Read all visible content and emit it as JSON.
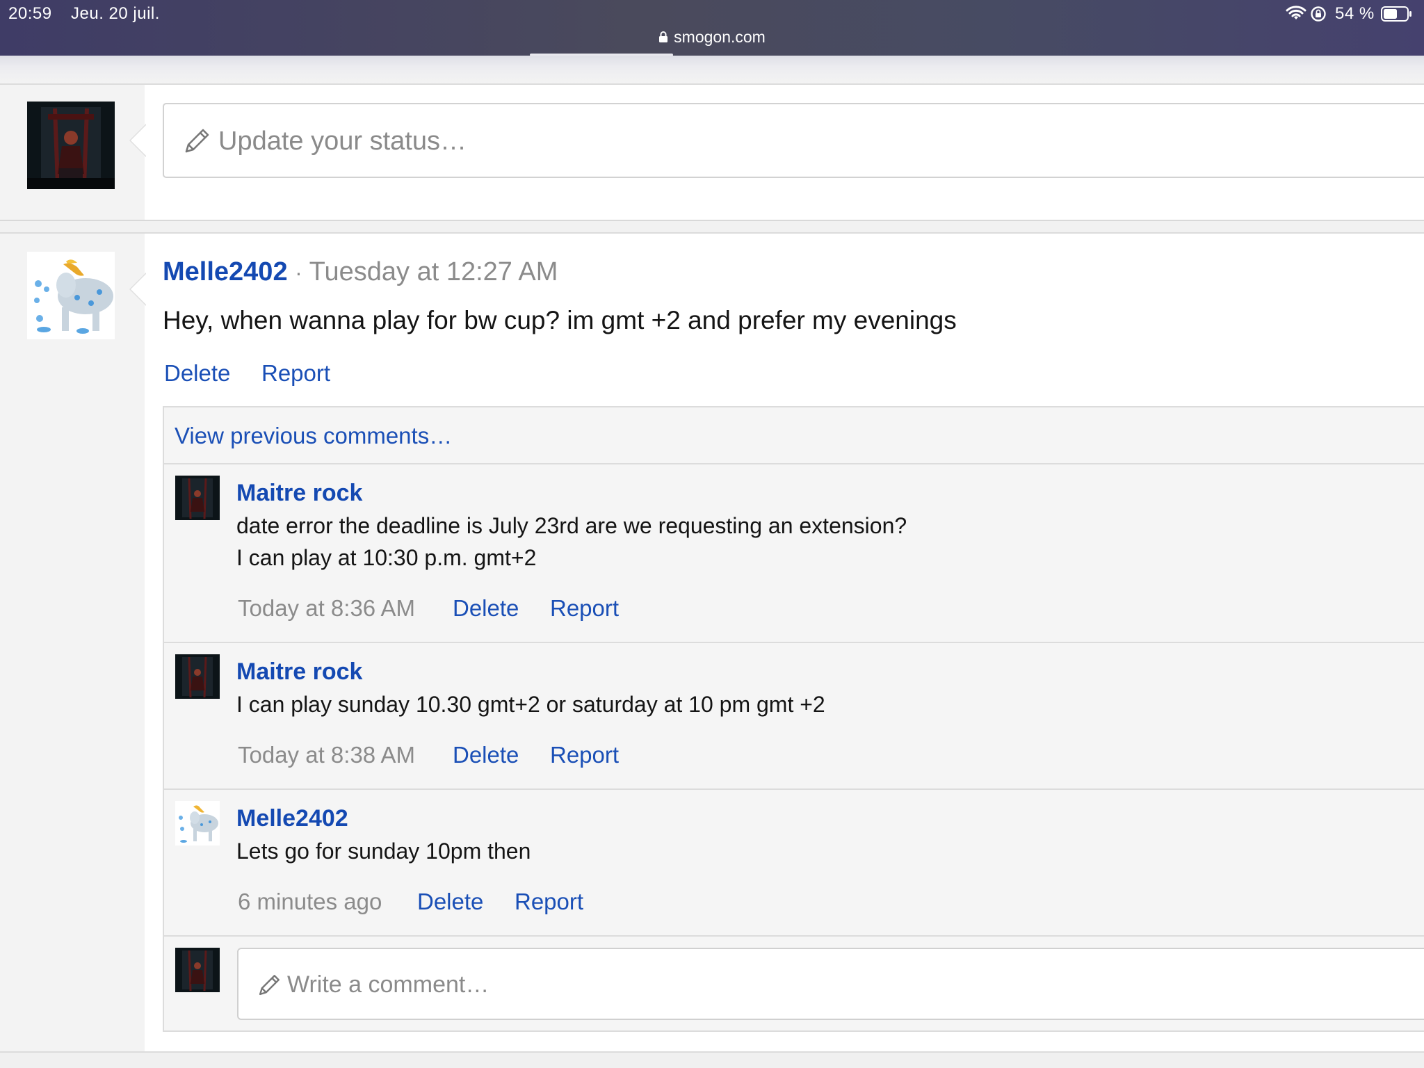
{
  "status_bar": {
    "time": "20:59",
    "date": "Jeu. 20 juil.",
    "battery": "54 %",
    "icons": [
      "wifi-icon",
      "orientation-lock-icon",
      "battery-icon"
    ]
  },
  "browser": {
    "url": "smogon.com",
    "lock_icon": "lock-icon"
  },
  "status_update": {
    "placeholder": "Update your status…"
  },
  "post": {
    "author": "Melle2402",
    "separator": "·",
    "timestamp": "Tuesday at 12:27 AM",
    "message": "Hey, when wanna play for bw cup? im gmt +2 and prefer my evenings",
    "actions": {
      "delete": "Delete",
      "report": "Report"
    }
  },
  "comments": {
    "view_previous": "View previous comments…",
    "items": [
      {
        "author": "Maitre rock",
        "lines": [
          "date error the deadline is July 23rd are we requesting an extension?",
          "I can play at 10:30 p.m. gmt+2"
        ],
        "timestamp": "Today at 8:36 AM",
        "delete": "Delete",
        "report": "Report"
      },
      {
        "author": "Maitre rock",
        "lines": [
          "I can play sunday 10.30 gmt+2 or saturday at 10 pm gmt +2"
        ],
        "timestamp": "Today at 8:38 AM",
        "delete": "Delete",
        "report": "Report"
      },
      {
        "author": "Melle2402",
        "lines": [
          "Lets go for sunday 10pm then"
        ],
        "timestamp": "6 minutes ago",
        "delete": "Delete",
        "report": "Report"
      }
    ],
    "write_placeholder": "Write a comment…"
  },
  "colors": {
    "link": "#1a4fb6",
    "username": "#1449b2",
    "muted": "#8b8b8b",
    "statusbar": "#45416e"
  }
}
